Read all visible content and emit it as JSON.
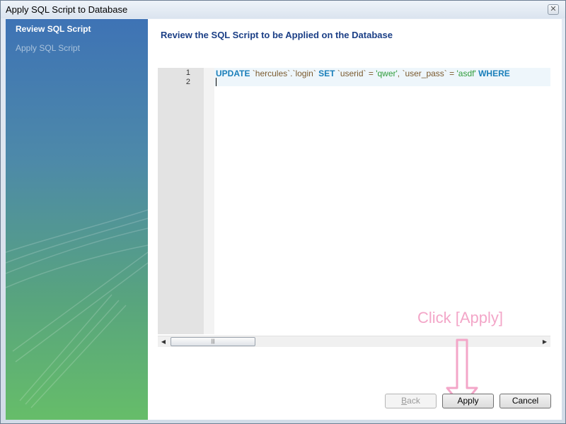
{
  "window": {
    "title": "Apply SQL Script to Database",
    "close_glyph": "✕"
  },
  "sidebar": {
    "items": [
      {
        "label": "Review SQL Script",
        "active": true
      },
      {
        "label": "Apply SQL Script",
        "active": false
      }
    ]
  },
  "main": {
    "heading": "Review the SQL Script to be Applied on the Database",
    "editor": {
      "line_numbers": [
        "1",
        "2"
      ],
      "tokens": {
        "t1": "UPDATE",
        "t2": " `hercules`.`login` ",
        "t3": "SET",
        "t4": " `userid` = ",
        "t5": "'qwer'",
        "t6": ", `user_pass` = ",
        "t7": "'asdf'",
        "t8": " ",
        "t9": "WHERE"
      },
      "scroll_thumb_glyph": "|||"
    }
  },
  "annotation": {
    "text": "Click [Apply]",
    "color": "#f3a6c8"
  },
  "buttons": {
    "back_first": "B",
    "back_rest": "ack",
    "apply": "Apply",
    "cancel": "Cancel"
  }
}
